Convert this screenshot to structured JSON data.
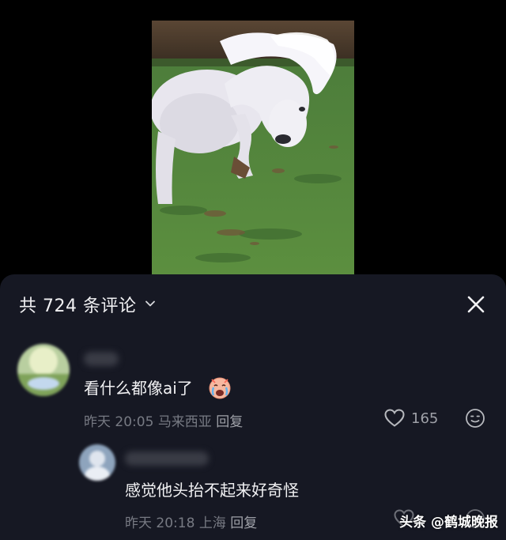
{
  "sheet": {
    "comment_count_label": "共 724 条评论",
    "comments": [
      {
        "text": "看什么都像ai了",
        "time": "昨天 20:05",
        "location": "马来西亚",
        "reply_label": "回复",
        "likes": "165"
      },
      {
        "text": "感觉他头抬不起来好奇怪",
        "time": "昨天 20:18",
        "location": "上海",
        "reply_label": "回复"
      }
    ]
  },
  "watermark": "头条 @鹤城晚报",
  "icons": {
    "count_chevron": "chevron-down-icon",
    "close": "close-icon",
    "like": "heart-outline-icon",
    "react": "emoji-reaction-icon",
    "emoji": "crying-face-emoji"
  },
  "colors": {
    "sheet_background": "#161823",
    "primary_text": "#f1f1f3",
    "secondary_text": "#777a83"
  }
}
